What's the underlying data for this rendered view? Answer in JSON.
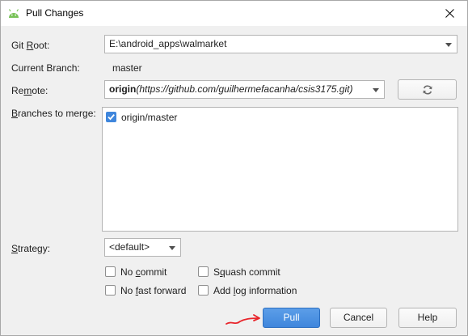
{
  "window": {
    "title": "Pull Changes",
    "close_label": "✕"
  },
  "form": {
    "git_root": {
      "label_pre": "Git ",
      "label_mn": "R",
      "label_post": "oot:",
      "value": "E:\\android_apps\\walmarket"
    },
    "current_branch": {
      "label": "Current Branch:",
      "value": "master"
    },
    "remote": {
      "label_pre": "Re",
      "label_mn": "m",
      "label_post": "ote:",
      "value_name": "origin",
      "value_url": "(https://github.com/guilhermefacanha/csis3175.git)"
    },
    "branches": {
      "label_mn": "B",
      "label_post": "ranches to merge:",
      "items": [
        {
          "label": "origin/master",
          "checked": true
        }
      ]
    },
    "strategy": {
      "label_mn": "S",
      "label_post": "trategy:",
      "value": "<default>"
    },
    "options": {
      "no_commit": {
        "pre": "No ",
        "mn": "c",
        "post": "ommit",
        "checked": false
      },
      "squash_commit": {
        "pre": "S",
        "mn": "q",
        "post": "uash commit",
        "checked": false
      },
      "no_fast_forward": {
        "pre": "No ",
        "mn": "f",
        "post": "ast forward",
        "checked": false
      },
      "add_log": {
        "pre": "Add ",
        "mn": "l",
        "post": "og information",
        "checked": false
      }
    }
  },
  "buttons": {
    "pull": "Pull",
    "cancel": "Cancel",
    "help": "Help"
  },
  "icons": {
    "app": "android-icon",
    "refresh": "refresh-icon",
    "close": "close-icon"
  },
  "colors": {
    "accent": "#3f86dc",
    "android_green": "#78c257",
    "annotation_red": "#e8252b"
  }
}
